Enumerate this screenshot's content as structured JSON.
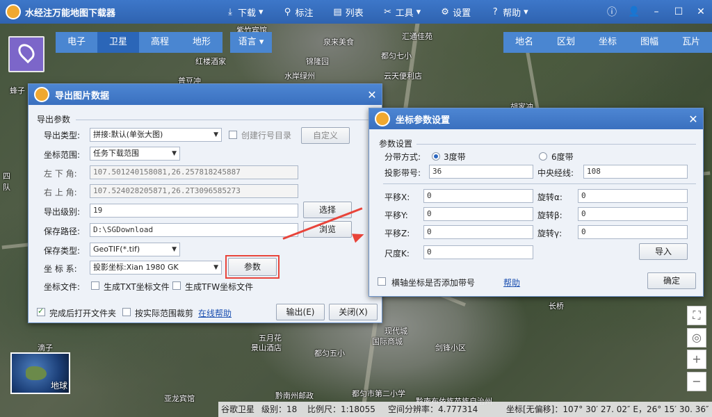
{
  "app": {
    "title": "水经注万能地图下载器"
  },
  "menu": [
    {
      "icon": "download-icon",
      "glyph": "⤓",
      "label": "下载",
      "dropdown": true
    },
    {
      "icon": "pin-icon",
      "glyph": "⬤",
      "label": "标注",
      "dropdown": false
    },
    {
      "icon": "list-icon",
      "glyph": "▤",
      "label": "列表",
      "dropdown": false
    },
    {
      "icon": "tools-icon",
      "glyph": "✕",
      "label": "工具",
      "dropdown": true
    },
    {
      "icon": "gear-icon",
      "glyph": "⚙",
      "label": "设置",
      "dropdown": false
    },
    {
      "icon": "help-icon",
      "glyph": "?",
      "label": "帮助",
      "dropdown": true
    }
  ],
  "map_tabs": [
    "电子",
    "卫星",
    "高程",
    "地形"
  ],
  "map_tab_active": "卫星",
  "language": "语言",
  "right_tabs": [
    "地名",
    "区划",
    "坐标",
    "图幅",
    "瓦片"
  ],
  "map_labels": [
    "紫竹宾馆",
    "泉来美食",
    "汇通佳苑",
    "都匀七小",
    "红楼酒家",
    "锦隆园",
    "水岸绿州",
    "云天便利店",
    "普豆冲",
    "蜂子",
    "胡家冲",
    "长桥",
    "五月花",
    "景山酒店",
    "都匀五小",
    "国际商城",
    "剑锋小区",
    "滴子",
    "黔南州邮政",
    "都匀市第二小学",
    "黔南布依族苗族自治州",
    "现代城",
    "亚龙宾馆",
    "四",
    "队"
  ],
  "export_dialog": {
    "title": "导出图片数据",
    "section": "导出参数",
    "type_label": "导出类型:",
    "type_value": "拼接:默认(单张大图)",
    "create_dir_label": "创建行号目录",
    "custom_btn": "自定义",
    "range_label": "坐标范围:",
    "range_value": "任务下载范围",
    "lower_left_label": "左 下 角:",
    "lower_left_value": "107.501240158081,26.257818245887",
    "upper_right_label": "右 上 角:",
    "upper_right_value": "107.524028205871,26.2T3096585273",
    "level_label": "导出级别:",
    "level_value": "19",
    "select_btn": "选择",
    "path_label": "保存路径:",
    "path_value": "D:\\SGDownload",
    "browse_btn": "浏览",
    "save_type_label": "保存类型:",
    "save_type_value": "GeoTIF(*.tif)",
    "crs_label": "坐 标 系:",
    "crs_value": "投影坐标:Xian 1980 GK",
    "params_btn": "参数",
    "coord_file_label": "坐标文件:",
    "txt_label": "生成TXT坐标文件",
    "tfw_label": "生成TFW坐标文件",
    "open_folder_label": "完成后打开文件夹",
    "crop_label": "按实际范围裁剪",
    "help_link": "在线帮助",
    "export_btn": "输出(E)",
    "close_btn": "关闭(X)"
  },
  "coord_dialog": {
    "title": "坐标参数设置",
    "section": "参数设置",
    "zone_label": "分带方式:",
    "zone3": "3度带",
    "zone6": "6度带",
    "zone_no_label": "投影带号:",
    "zone_no_value": "36",
    "central_label": "中央经线:",
    "central_value": "108",
    "dx_label": "平移X:",
    "dx_value": "0",
    "dy_label": "平移Y:",
    "dy_value": "0",
    "dz_label": "平移Z:",
    "dz_value": "0",
    "rx_label": "旋转α:",
    "rx_value": "0",
    "ry_label": "旋转β:",
    "ry_value": "0",
    "rz_label": "旋转γ:",
    "rz_value": "0",
    "scale_label": "尺度K:",
    "scale_value": "0",
    "import_btn": "导入",
    "add_zone_label": "横轴坐标是否添加带号",
    "help_link": "帮助",
    "ok_btn": "确定"
  },
  "globe_label": "地球",
  "status": {
    "source": "谷歌卫星",
    "level": "级别：18",
    "scale": "比例尺：1:18055",
    "resolution": "空间分辨率：4.777314",
    "coords": "坐标[无偏移]：107° 30′ 27. 02″ E，26° 15′ 30. 36″ N"
  }
}
